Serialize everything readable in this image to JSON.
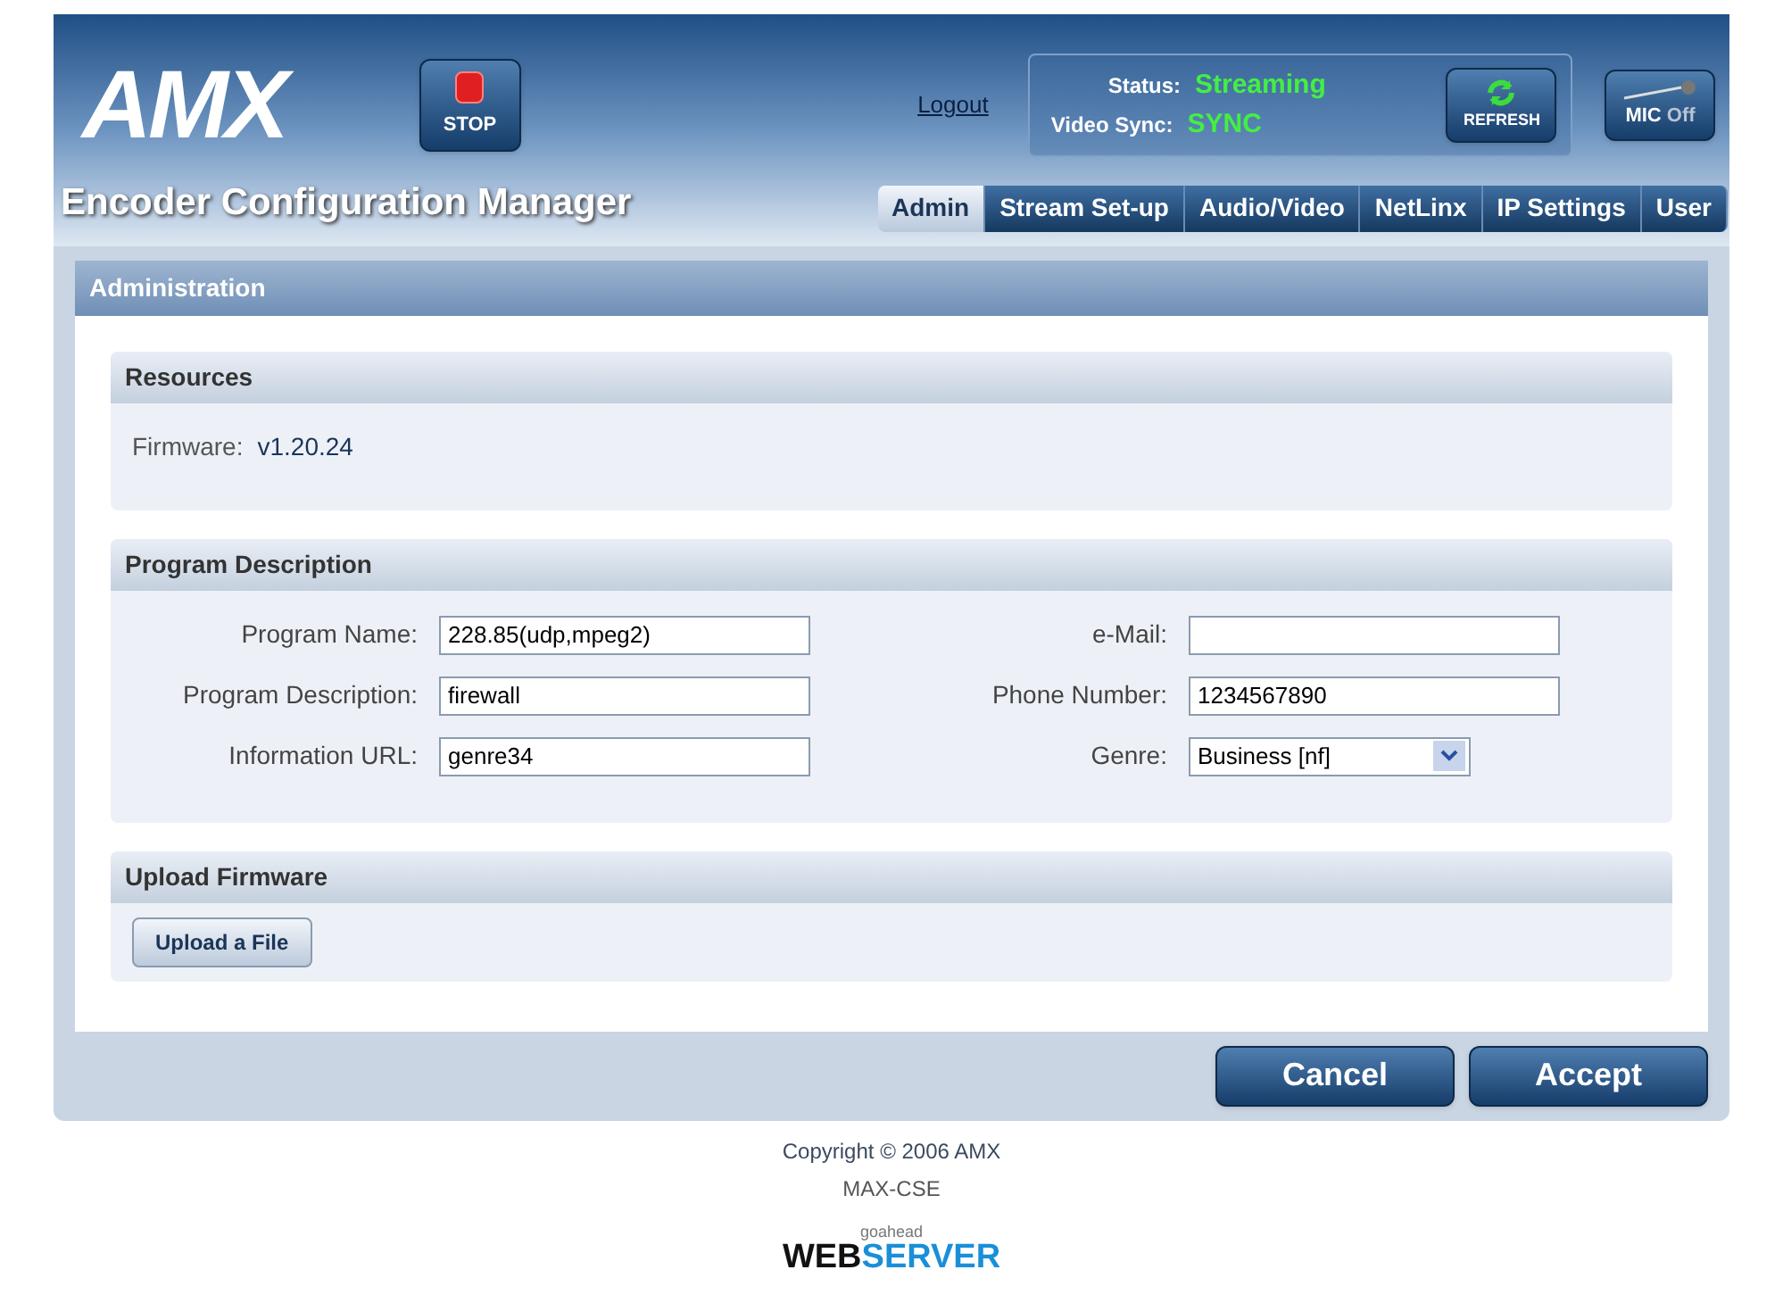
{
  "header": {
    "logo": "AMX",
    "stop_button": "STOP",
    "logout_link": "Logout",
    "status": {
      "label": "Status:",
      "value": "Streaming"
    },
    "video_sync": {
      "label": "Video Sync:",
      "value": "SYNC"
    },
    "refresh_button": "REFRESH",
    "mic_button": {
      "label": "MIC",
      "state": "Off",
      "on": false
    }
  },
  "title": "Encoder Configuration Manager",
  "tabs": [
    {
      "label": "Admin",
      "selected": true
    },
    {
      "label": "Stream Set-up",
      "selected": false
    },
    {
      "label": "Audio/Video",
      "selected": false
    },
    {
      "label": "NetLinx",
      "selected": false
    },
    {
      "label": "IP Settings",
      "selected": false
    },
    {
      "label": "User",
      "selected": false
    }
  ],
  "panel": {
    "title": "Administration",
    "resources": {
      "title": "Resources",
      "firmware_label": "Firmware:",
      "firmware_value": "v1.20.24"
    },
    "program_description": {
      "title": "Program Description",
      "left_fields": [
        {
          "label": "Program Name:",
          "value": "228.85(udp,mpeg2)"
        },
        {
          "label": "Program Description:",
          "value": "firewall"
        },
        {
          "label": "Information URL:",
          "value": "genre34"
        }
      ],
      "right_fields": [
        {
          "label": "e-Mail:",
          "kind": "text"
        },
        {
          "label": "Phone Number:",
          "value": "1234567890",
          "kind": "text"
        },
        {
          "label": "Genre:",
          "value": "Business [nf]",
          "kind": "select"
        }
      ]
    },
    "upload_firmware": {
      "title": "Upload Firmware",
      "button": "Upload a File"
    },
    "buttons": [
      "Cancel",
      "Accept"
    ]
  },
  "footer": {
    "copyright": "Copyright © 2006 AMX",
    "model": "MAX-CSE",
    "badge_small": "goahead",
    "badge_web": "WEB",
    "badge_server": "SERVER"
  }
}
